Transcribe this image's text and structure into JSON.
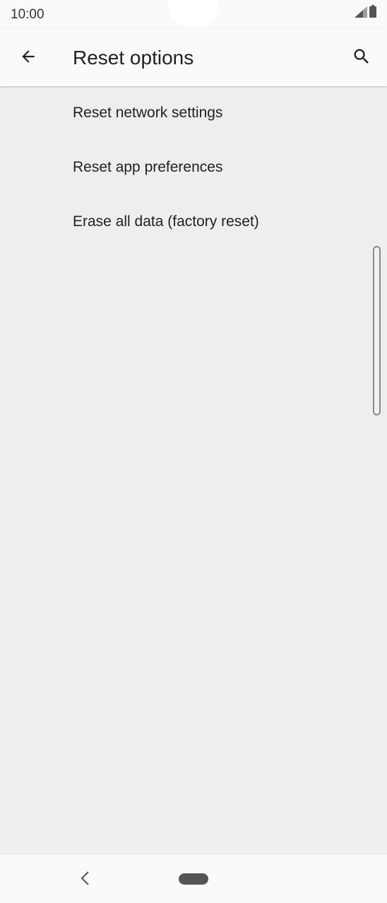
{
  "status_bar": {
    "time": "10:00",
    "signal_icon": "cell-signal-icon",
    "battery_icon": "battery-icon"
  },
  "app_bar": {
    "title": "Reset options",
    "back_icon": "arrow-back-icon",
    "search_icon": "search-icon"
  },
  "options": [
    {
      "label": "Reset network settings"
    },
    {
      "label": "Reset app preferences"
    },
    {
      "label": "Erase all data (factory reset)"
    }
  ],
  "nav_bar": {
    "back_icon": "nav-back-icon",
    "home_icon": "home-pill-icon"
  },
  "colors": {
    "background": "#eeeeee",
    "bar": "#fafafa",
    "text": "#202124"
  }
}
